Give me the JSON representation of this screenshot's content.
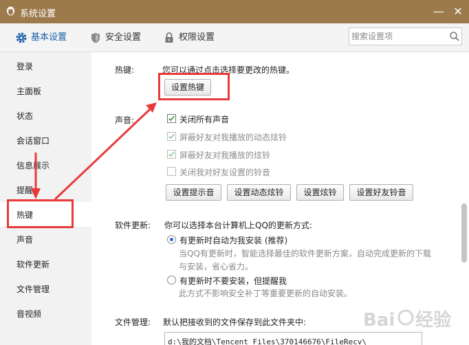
{
  "window": {
    "title": "系统设置",
    "minimize_glyph": "—",
    "close_glyph": "✕"
  },
  "tabs": [
    {
      "label": "基本设置",
      "icon": "gear-icon",
      "active": true
    },
    {
      "label": "安全设置",
      "icon": "shield-icon",
      "active": false
    },
    {
      "label": "权限设置",
      "icon": "lock-icon",
      "active": false
    }
  ],
  "search": {
    "placeholder": "搜索设置项"
  },
  "sidebar": {
    "items": [
      {
        "label": "登录"
      },
      {
        "label": "主面板"
      },
      {
        "label": "状态"
      },
      {
        "label": "会话窗口"
      },
      {
        "label": "信息展示"
      },
      {
        "label": "提醒"
      },
      {
        "label": "热键",
        "active": true
      },
      {
        "label": "声音"
      },
      {
        "label": "软件更新"
      },
      {
        "label": "文件管理"
      },
      {
        "label": "音视频"
      }
    ]
  },
  "hotkey": {
    "label": "热键:",
    "description": "您可以通过点击选择要更改的热键。",
    "button": "设置热键"
  },
  "sound": {
    "label": "声音:",
    "options": [
      {
        "label": "关闭所有声音",
        "checked": true,
        "enabled": true
      },
      {
        "label": "屏蔽好友对我播放的动态炫铃",
        "checked": true,
        "enabled": false
      },
      {
        "label": "屏蔽好友对我播放的炫铃",
        "checked": true,
        "enabled": false
      },
      {
        "label": "关闭我对好友设置的铃音",
        "checked": false,
        "enabled": false
      }
    ],
    "buttons": [
      "设置提示音",
      "设置动态炫铃",
      "设置炫铃",
      "设置好友铃音"
    ]
  },
  "update": {
    "label": "软件更新:",
    "description": "你可以选择本台计算机上QQ的更新方式:",
    "options": [
      {
        "label": "有更新时自动为我安装 (推荐)",
        "selected": true,
        "detail": [
          "当QQ有更新时，智能选择最佳的软件更新方案，自动完成更新的下载",
          "与安装，省心省力。"
        ]
      },
      {
        "label": "有更新时不要安装，但提醒我",
        "selected": false,
        "detail": [
          "此方式不影响安全补丁等重要更新的自动安装。"
        ]
      }
    ]
  },
  "file": {
    "label": "文件管理:",
    "description": "默认把接收到的文件保存到此文件夹中:",
    "path": "d:\\我的文档\\Tencent Files\\370146676\\FileRecv\\"
  },
  "colors": {
    "titlebar": "#9c7a4c",
    "accent": "#1a5fa8",
    "annotation": "#e83a3a",
    "check": "#2e9a3a"
  }
}
